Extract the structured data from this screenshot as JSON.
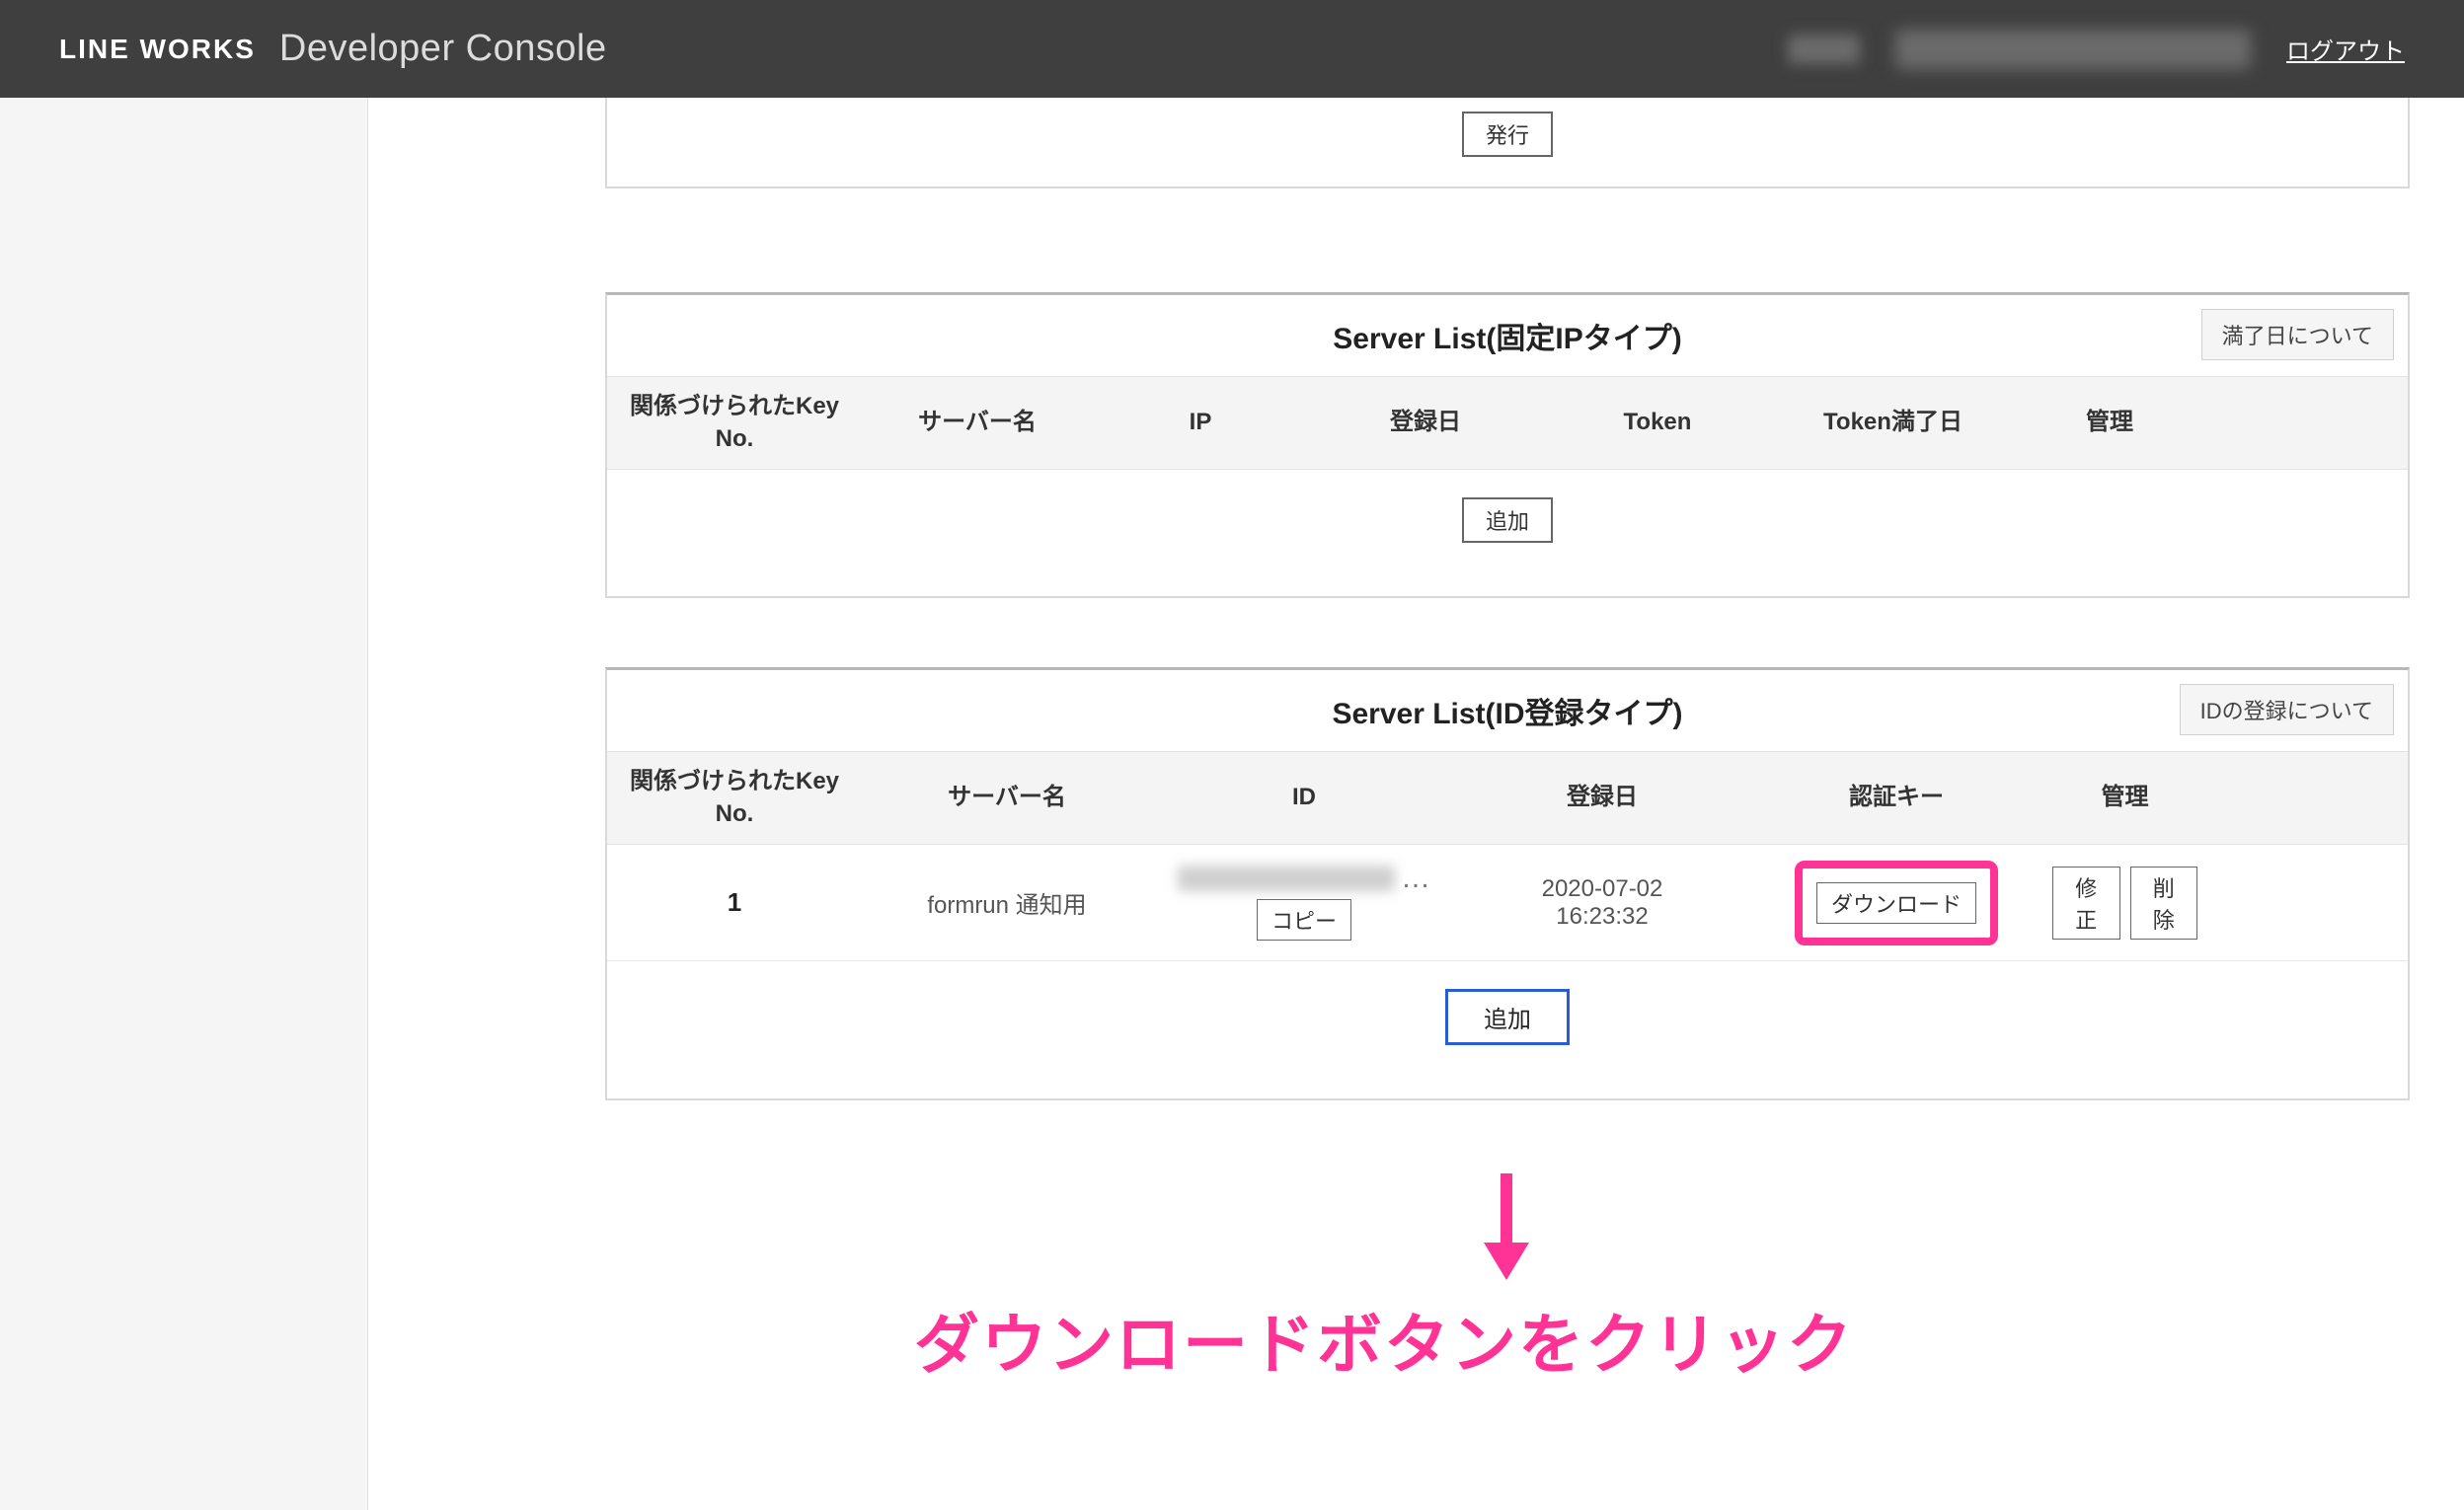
{
  "header": {
    "brand": "LINE WORKS",
    "title": "Developer Console",
    "logout": "ログアウト"
  },
  "top_card": {
    "issue_btn": "発行"
  },
  "fixed_list": {
    "title": "Server List(固定IPタイプ)",
    "help_btn": "満了日について",
    "columns": {
      "keyno": "関係づけられたKey No.",
      "server": "サーバー名",
      "ip": "IP",
      "regdate": "登録日",
      "token": "Token",
      "tokendate": "Token満了日",
      "manage": "管理"
    },
    "add_btn": "追加"
  },
  "idreg_list": {
    "title": "Server List(ID登録タイプ)",
    "help_btn": "IDの登録について",
    "columns": {
      "keyno": "関係づけられたKey No.",
      "server": "サーバー名",
      "id": "ID",
      "regdate": "登録日",
      "authkey": "認証キー",
      "manage": "管理"
    },
    "rows": [
      {
        "keyno": "1",
        "server": "formrun 通知用",
        "copy_btn": "コピー",
        "regdate_line1": "2020-07-02",
        "regdate_line2": "16:23:32",
        "download_btn": "ダウンロード",
        "edit_btn": "修正",
        "delete_btn": "削除"
      }
    ],
    "add_btn": "追加"
  },
  "annotation": {
    "text": "ダウンロードボタンをクリック"
  }
}
